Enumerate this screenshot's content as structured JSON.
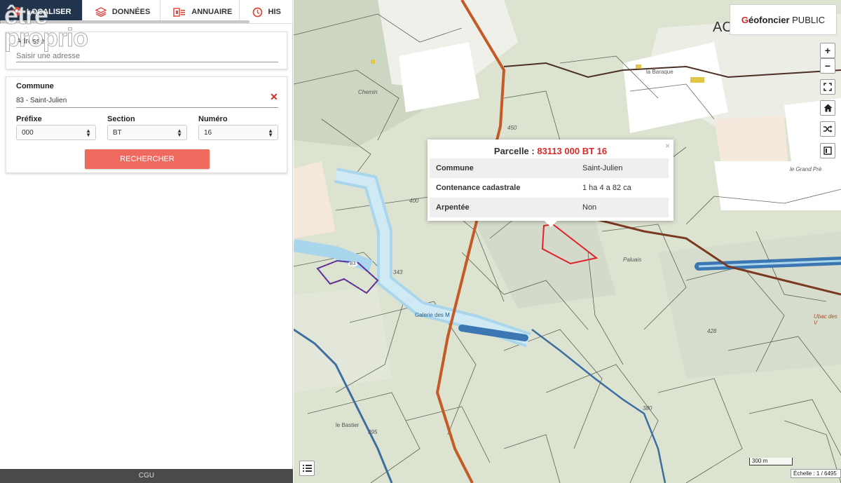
{
  "watermark": "être\nproprio",
  "tabs": [
    {
      "label": "LOCALISER",
      "icon": "location-pin-icon",
      "active": true
    },
    {
      "label": "DONNÉES",
      "icon": "layers-icon",
      "active": false
    },
    {
      "label": "ANNUAIRE",
      "icon": "directory-icon",
      "active": false
    },
    {
      "label": "HIS",
      "icon": "clock-history-icon",
      "active": false
    }
  ],
  "adresse": {
    "label": "Adresse",
    "placeholder": "Saisir une adresse"
  },
  "search": {
    "commune_label": "Commune",
    "commune_value": "83 - Saint-Julien",
    "prefixe_label": "Préfixe",
    "prefixe_value": "000",
    "section_label": "Section",
    "section_value": "BT",
    "numero_label": "Numéro",
    "numero_value": "16",
    "button_label": "RECHERCHER"
  },
  "footer": {
    "label": "CGU"
  },
  "brand": {
    "name_bold": "éofoncier",
    "initial": "G",
    "suffix": "PUBLIC"
  },
  "map_controls": {
    "zoom_in": "+",
    "zoom_out": "−"
  },
  "popup": {
    "title_prefix": "Parcelle : ",
    "parcel_ref": "83113 000 BT 16",
    "close": "×",
    "rows": [
      {
        "key": "Commune",
        "value": "Saint-Julien"
      },
      {
        "key": "Contenance cadastrale",
        "value": "1 ha 4 a 82 ca"
      },
      {
        "key": "Arpentée",
        "value": "Non"
      }
    ]
  },
  "map_labels": {
    "top_right": "AC",
    "la_baraque": "la Baraque",
    "canal": "Galerie des M",
    "le_bastier": "le Bastier",
    "paluais": "Paluais",
    "ubac": "Ubac des V",
    "grand_pre": "le Grand Pré",
    "alt_450": "450",
    "alt_400": "400",
    "alt_343": "343",
    "alt_428": "428",
    "alt_395": "395",
    "alt_380": "380",
    "chemin": "Chemin",
    "road_num": "B3"
  },
  "scale": {
    "bar": "300 m",
    "text": "Échelle : 1 / 6495"
  }
}
